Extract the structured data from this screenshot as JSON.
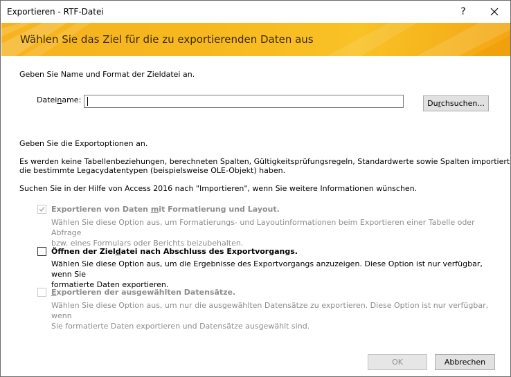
{
  "window": {
    "title": "Exportieren - RTF-Datei",
    "help_label": "?",
    "icons": {
      "help": "help-icon",
      "close": "close-icon",
      "check": "checkmark-icon"
    }
  },
  "banner": {
    "heading": "Wählen Sie das Ziel für die zu exportierenden Daten aus",
    "color": "#f7b81f"
  },
  "destination": {
    "intro": "Geben Sie Name und Format der Zieldatei an.",
    "file_label_pre": "Datei",
    "file_label_underlined": "n",
    "file_label_post": "ame:",
    "file_value": "",
    "browse_pre": "Du",
    "browse_underlined": "r",
    "browse_post": "chsuchen..."
  },
  "export_options": {
    "intro": "Geben Sie die Exportoptionen an.",
    "info_line1": "Es werden keine Tabellenbeziehungen, berechneten Spalten, Gültigkeitsprüfungsregeln, Standardwerte sowie Spalten importiert,",
    "info_line2": "die bestimmte Legacydatentypen (beispielsweise OLE-Objekt) haben.",
    "help_hint": "Suchen Sie in der Hilfe von Access 2016 nach \"Importieren\", wenn Sie weitere Informationen wünschen.",
    "options": [
      {
        "title_pre": "Exportieren von Daten ",
        "title_underlined": "m",
        "title_post": "it Formatierung und Layout.",
        "desc_line1": "Wählen Sie diese Option aus, um Formatierungs- und Layoutinformationen beim Exportieren einer Tabelle oder Abfrage",
        "desc_line2": "bzw. eines Formulars oder Berichts beizubehalten.",
        "checked": true,
        "enabled": false
      },
      {
        "title_pre": "Öffnen der Ziel",
        "title_underlined": "d",
        "title_post": "atei nach Abschluss des Exportvorgangs.",
        "desc_line1": "Wählen Sie diese Option aus, um die Ergebnisse des Exportvorgangs anzuzeigen. Diese Option ist nur verfügbar, wenn Sie",
        "desc_line2": "formatierte Daten exportieren.",
        "checked": false,
        "enabled": true
      },
      {
        "title_pre": "",
        "title_underlined": "E",
        "title_post": "xportieren der ausgewählten Datensätze.",
        "desc_line1": "Wählen Sie diese Option aus, um nur die ausgewählten Datensätze zu exportieren. Diese Option ist nur verfügbar, wenn",
        "desc_line2": "Sie formatierte Daten exportieren und Datensätze ausgewählt sind.",
        "checked": false,
        "enabled": false
      }
    ]
  },
  "footer": {
    "ok_label": "OK",
    "cancel_label": "Abbrechen"
  }
}
